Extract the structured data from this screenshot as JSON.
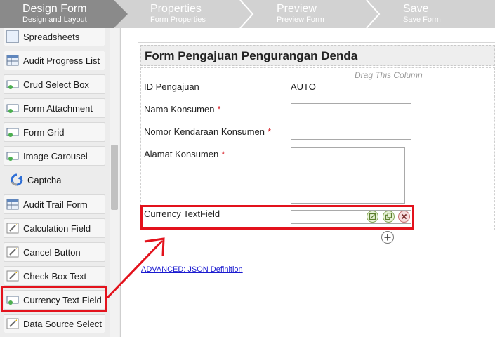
{
  "steps": [
    {
      "title": "Design Form",
      "subtitle": "Design and Layout",
      "active": true
    },
    {
      "title": "Properties",
      "subtitle": "Form Properties",
      "active": false
    },
    {
      "title": "Preview",
      "subtitle": "Preview Form",
      "active": false
    },
    {
      "title": "Save",
      "subtitle": "Save Form",
      "active": false
    }
  ],
  "palette": {
    "items": [
      {
        "label": "Spreadsheets",
        "icon": "spreadsheet-icon"
      },
      {
        "label": "Audit Progress List",
        "icon": "table-icon"
      },
      {
        "label": "Crud Select Box",
        "icon": "field-icon"
      },
      {
        "label": "Form Attachment",
        "icon": "field-icon"
      },
      {
        "label": "Form Grid",
        "icon": "field-icon"
      },
      {
        "label": "Image Carousel",
        "icon": "field-icon"
      },
      {
        "label": "Captcha",
        "icon": "captcha-icon"
      },
      {
        "label": "Audit Trail Form",
        "icon": "table-icon"
      },
      {
        "label": "Calculation Field",
        "icon": "pencil-icon"
      },
      {
        "label": "Cancel Button",
        "icon": "pencil-icon"
      },
      {
        "label": "Check Box Text",
        "icon": "pencil-icon"
      },
      {
        "label": "Currency Text Field",
        "icon": "field-icon"
      },
      {
        "label": "Data Source Select",
        "icon": "pencil-icon"
      }
    ]
  },
  "form": {
    "title": "Form Pengajuan Pengurangan Denda",
    "drag_hint": "Drag This Column",
    "required_mark": "*",
    "fields": {
      "id_label": "ID Pengajuan",
      "id_value": "AUTO",
      "nama_label": "Nama Konsumen",
      "nomor_label": "Nomor Kendaraan Konsumen",
      "alamat_label": "Alamat Konsumen",
      "currency_label": "Currency TextField"
    },
    "advanced_link": "ADVANCED: JSON Definition"
  },
  "colors": {
    "highlight": "#e3121c",
    "active_step": "#8a8a8a",
    "inactive_step": "#d2d2d2"
  }
}
